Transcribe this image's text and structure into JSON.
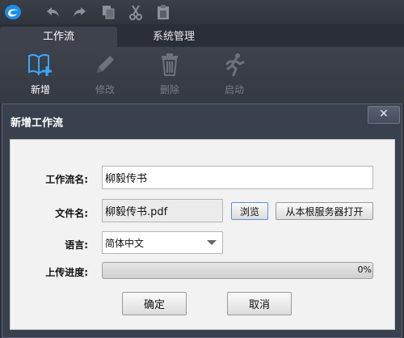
{
  "topbar": {
    "icons": [
      "app-logo-icon",
      "undo-icon",
      "redo-icon",
      "copy-icon",
      "cut-icon",
      "paste-icon"
    ]
  },
  "tabs": [
    {
      "label": "工作流",
      "active": true
    },
    {
      "label": "系统管理",
      "active": false
    }
  ],
  "ribbon": {
    "buttons": [
      {
        "label": "新增",
        "icon": "book-add-icon",
        "enabled": true
      },
      {
        "label": "修改",
        "icon": "pencil-icon",
        "enabled": false
      },
      {
        "label": "删除",
        "icon": "trash-icon",
        "enabled": false
      },
      {
        "label": "启动",
        "icon": "running-man-icon",
        "enabled": false
      }
    ]
  },
  "dialog": {
    "title": "新增工作流",
    "close_label": "✕",
    "form": {
      "name_label": "工作流名:",
      "name_value": "柳毅传书",
      "file_label": "文件名:",
      "file_value": "柳毅传书.pdf",
      "browse_label": "浏览",
      "open_from_server_label": "从本根服务器打开",
      "language_label": "语言:",
      "language_value": "简体中文",
      "progress_label": "上传进度:",
      "progress_percent": 0,
      "progress_text": "0%"
    },
    "ok_label": "确定",
    "cancel_label": "取消"
  },
  "colors": {
    "accent": "#4aa8ff",
    "background": "#2c3039",
    "dialog": "#39414f"
  }
}
